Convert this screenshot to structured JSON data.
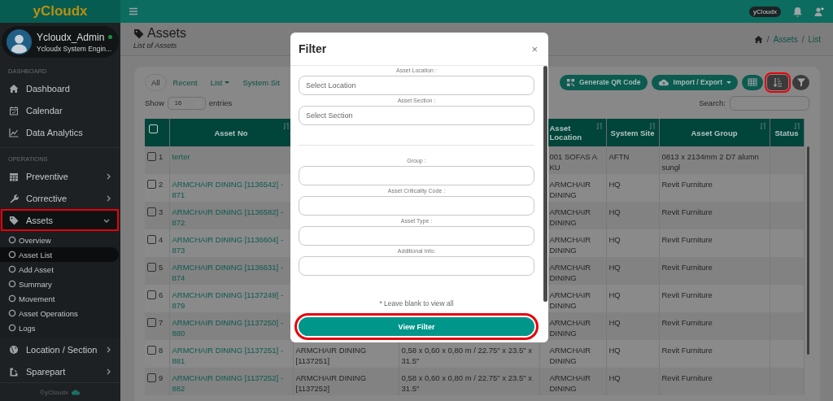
{
  "topbar": {
    "logo": "yCloudx",
    "badge": "yCloudx"
  },
  "sidebar": {
    "user": {
      "name": "Ycloudx_Admin",
      "role": "Ycloudx System Engin...",
      "online": true
    },
    "sections": [
      {
        "title": "DASHBOARD",
        "items": [
          {
            "label": "Dashboard",
            "highlighted": false
          },
          {
            "label": "Calendar",
            "highlighted": false
          },
          {
            "label": "Data Analytics",
            "highlighted": false
          }
        ]
      },
      {
        "title": "OPERATIONS",
        "items": [
          {
            "label": "Preventive",
            "highlighted": false,
            "expanded": false
          },
          {
            "label": "Corrective",
            "highlighted": false,
            "expanded": false
          },
          {
            "label": "Assets",
            "highlighted": true,
            "expanded": true,
            "children": [
              {
                "label": "Overview",
                "selected": false
              },
              {
                "label": "Asset List",
                "selected": true
              },
              {
                "label": "Add Asset",
                "selected": false
              },
              {
                "label": "Summary",
                "selected": false
              },
              {
                "label": "Movement",
                "selected": false
              },
              {
                "label": "Asset Operations",
                "selected": false
              },
              {
                "label": "Logs",
                "selected": false
              }
            ]
          },
          {
            "label": "Location / Section",
            "highlighted": false,
            "expanded": false
          },
          {
            "label": "Sparepart",
            "highlighted": false,
            "expanded": false
          }
        ]
      }
    ],
    "footer": "©yCloudx"
  },
  "page": {
    "title": "Assets",
    "subtitle": "List of Assets",
    "breadcrumb": [
      {
        "separator": "/",
        "label": "Assets"
      },
      {
        "separator": "/",
        "label": "List"
      }
    ]
  },
  "tabs": [
    {
      "label": "All",
      "selected": true,
      "dropdown": false
    },
    {
      "label": "Recent",
      "selected": false,
      "dropdown": false
    },
    {
      "label": "List",
      "selected": false,
      "dropdown": true
    },
    {
      "label": "System Sit",
      "selected": false,
      "dropdown": false
    }
  ],
  "toolbar": [
    {
      "label": "Generate QR Code",
      "kind": "pill",
      "dropdown": false,
      "highlighted": false
    },
    {
      "label": "Import / Export",
      "kind": "pill",
      "dropdown": true,
      "highlighted": false
    },
    {
      "kind": "icon",
      "dropdown": false,
      "highlighted": false
    },
    {
      "kind": "icon",
      "dropdown": false,
      "highlighted": true
    },
    {
      "kind": "round",
      "dropdown": false,
      "highlighted": false
    }
  ],
  "length": {
    "before": "Show",
    "value": "16",
    "after": "entries"
  },
  "search": {
    "label": "Search:"
  },
  "table": {
    "select_all_checked": false,
    "columns": [
      {
        "label": "Asset No"
      },
      {},
      {},
      {
        "label": "Asset Location"
      },
      {
        "label": "System Site"
      },
      {
        "label": "Asset Group"
      },
      {
        "label": "Status"
      }
    ],
    "rows": [
      {
        "checked": false,
        "number": "1",
        "asset_no": "terter",
        "location": "001 SOFAS A KU",
        "site": "AFTN",
        "group": "0813 x 2134mm 2 D7 alumn sungl"
      },
      {
        "checked": false,
        "number": "2",
        "asset_no": "ARMCHAIR DINING [1136542] - 871",
        "location": "ARMCHAIR DINING",
        "site": "HQ",
        "group": "Revit Furniture"
      },
      {
        "checked": false,
        "number": "3",
        "asset_no": "ARMCHAIR DINING [1136582] - 872",
        "location": "ARMCHAIR DINING",
        "site": "HQ",
        "group": "Revit Furniture"
      },
      {
        "checked": false,
        "number": "4",
        "asset_no": "ARMCHAIR DINING [1136604] - 873",
        "location": "ARMCHAIR DINING",
        "site": "HQ",
        "group": "Revit Furniture"
      },
      {
        "checked": false,
        "number": "5",
        "asset_no": "ARMCHAIR DINING [1136631] - 874",
        "location": "ARMCHAIR DINING",
        "site": "HQ",
        "group": "Revit Furniture"
      },
      {
        "checked": false,
        "number": "6",
        "asset_no": "ARMCHAIR DINING [1137249] - 879",
        "location": "ARMCHAIR DINING",
        "site": "HQ",
        "group": "Revit Furniture"
      },
      {
        "checked": false,
        "number": "7",
        "asset_no": "ARMCHAIR DINING [1137250] - 880",
        "location": "ARMCHAIR DINING",
        "site": "HQ",
        "group": "Revit Furniture"
      },
      {
        "checked": false,
        "number": "8",
        "asset_no": "ARMCHAIR DINING [1137251] - 881",
        "column_3": "ARMCHAIR DINING [1137251]",
        "column_4": "0,58 x 0,60 x 0,80 m / 22.75\" x 23.5\" x 31.5\"",
        "location": "ARMCHAIR DINING",
        "site": "HQ",
        "group": "Revit Furniture"
      },
      {
        "checked": false,
        "number": "9",
        "asset_no": "ARMCHAIR DINING [1137252] - 882",
        "column_3": "ARMCHAIR DINING [1137252]",
        "column_4": "0,58 x 0,60 x 0,80 m / 22.75\" x 23.5\" x 31.5\"",
        "location": "ARMCHAIR DINING",
        "site": "HQ",
        "group": "Revit Furniture"
      }
    ]
  },
  "modal": {
    "title": "Filter",
    "close": "×",
    "groups": [
      [
        {
          "label": "Asset Location :",
          "placeholder": "Select Location"
        },
        {
          "label": "Asset Section :",
          "placeholder": "Select Section"
        }
      ],
      [
        {
          "label": "Group :"
        },
        {
          "label": "Asset Criticality Code :"
        },
        {
          "label": "Asset Type :"
        },
        {
          "label": "Additional Info:"
        }
      ]
    ],
    "note": "* Leave blank to view all",
    "button": {
      "label": "View Filter",
      "highlighted": true
    }
  }
}
